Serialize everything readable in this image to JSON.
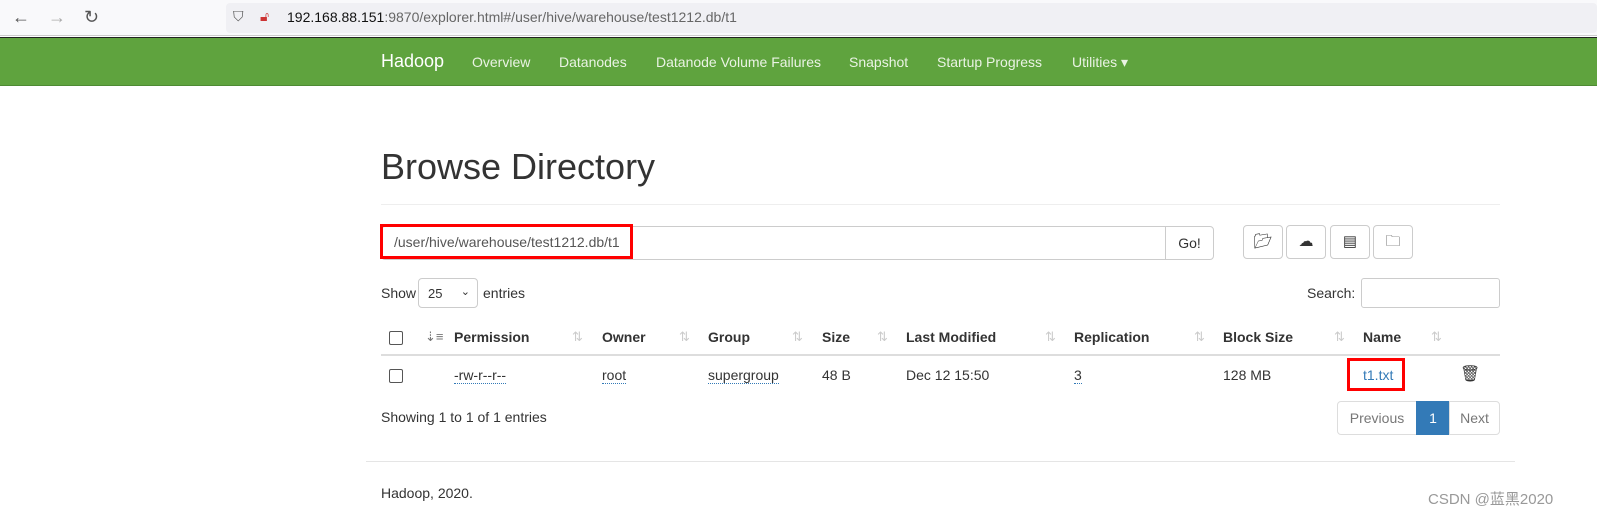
{
  "browser": {
    "url_host": "192.168.88.151",
    "url_rest": ":9870/explorer.html#/user/hive/warehouse/test1212.db/t1"
  },
  "nav": {
    "brand": "Hadoop",
    "items": [
      "Overview",
      "Datanodes",
      "Datanode Volume Failures",
      "Snapshot",
      "Startup Progress",
      "Utilities ▾"
    ]
  },
  "page": {
    "title": "Browse Directory",
    "path": "/user/hive/warehouse/test1212.db/t1",
    "go": "Go!"
  },
  "toolbar": {
    "icons": [
      "folder-open-icon",
      "cloud-upload-icon",
      "list-alt-icon",
      "folder-plus-icon"
    ]
  },
  "table_controls": {
    "show": "Show",
    "entries_value": "25",
    "entries": "entries",
    "search_label": "Search:",
    "search_value": ""
  },
  "table": {
    "columns": [
      "Permission",
      "Owner",
      "Group",
      "Size",
      "Last Modified",
      "Replication",
      "Block Size",
      "Name"
    ],
    "rows": [
      {
        "permission": "-rw-r--r--",
        "owner": "root",
        "group": "supergroup",
        "size": "48 B",
        "modified": "Dec 12 15:50",
        "replication": "3",
        "block_size": "128 MB",
        "name": "t1.txt"
      }
    ]
  },
  "footer_info": "Showing 1 to 1 of 1 entries",
  "pagination": {
    "previous": "Previous",
    "current": "1",
    "next": "Next"
  },
  "footer": "Hadoop, 2020.",
  "watermark": "CSDN @蓝黑2020",
  "colors": {
    "nav": "#5fa33e",
    "link": "#337ab7",
    "active_page": "#337ab7",
    "highlight": "#ff0000"
  }
}
